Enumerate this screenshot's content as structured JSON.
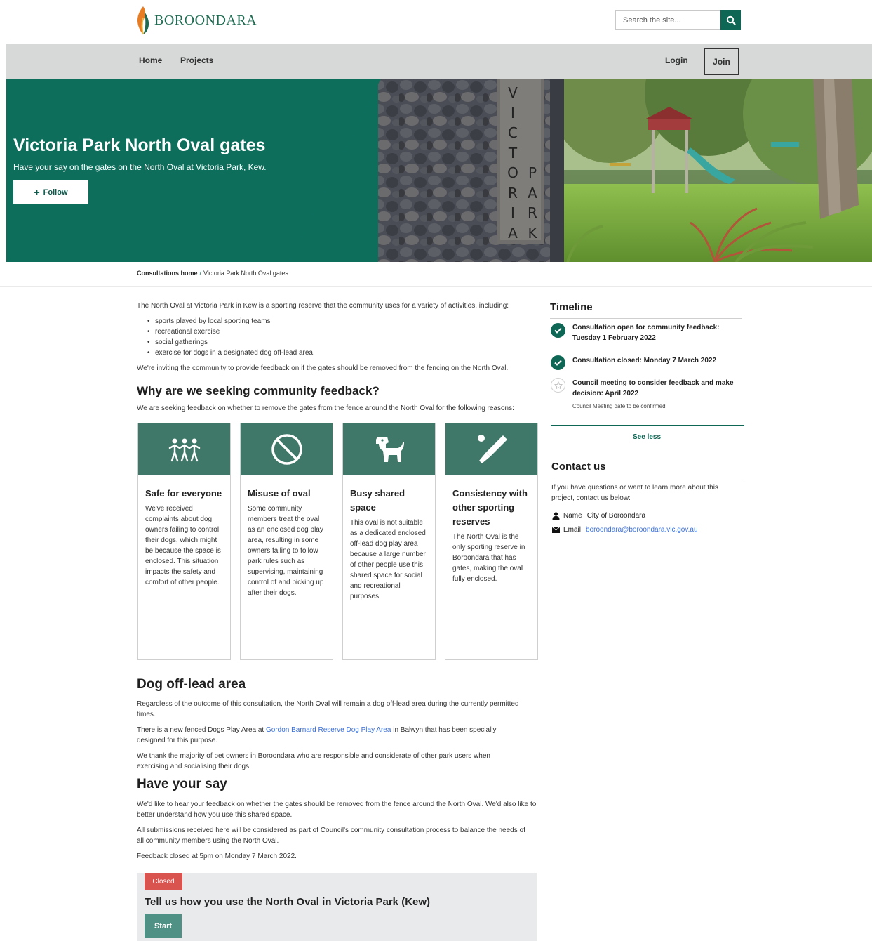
{
  "brand": {
    "logo_text": "Boroondara"
  },
  "search": {
    "placeholder": "Search the site..."
  },
  "nav": {
    "home": "Home",
    "projects": "Projects",
    "login": "Login",
    "join": "Join"
  },
  "hero": {
    "title": "Victoria Park North Oval gates",
    "subtitle": "Have your say on the gates on the North Oval at Victoria Park, Kew.",
    "follow_label": "Follow",
    "sign_letters_left": [
      "V",
      "I",
      "C",
      "T",
      "O",
      "R",
      "I",
      "A"
    ],
    "sign_letters_right": [
      "P",
      "A",
      "R",
      "K"
    ]
  },
  "breadcrumb": {
    "home": "Consultations home",
    "separator": "/",
    "current": "Victoria Park North Oval gates"
  },
  "main": {
    "intro": "The North Oval at Victoria Park in Kew is a sporting reserve that the community uses for a variety of activities, including:",
    "bullets": [
      "sports played by local sporting teams",
      "recreational exercise",
      "social gatherings",
      "exercise for dogs in a designated dog off-lead area."
    ],
    "inviting": "We're inviting the community to provide feedback on if the gates should be removed from the fencing on the North Oval.",
    "why_heading": "Why are we seeking community feedback?",
    "why_text": "We are seeking feedback on whether to remove the gates from the fence around the North Oval for the following reasons:",
    "cards": [
      {
        "icon": "people-icon",
        "title": "Safe for everyone",
        "body": "We've received complaints about dog owners failing to control their dogs, which might be because the space is enclosed. This situation impacts the safety and comfort of other people."
      },
      {
        "icon": "prohibited-icon",
        "title": "Misuse of oval",
        "body": "Some community members treat the oval as an enclosed dog play area, resulting in some owners failing to follow park rules such as supervising, maintaining control of and picking up after their dogs."
      },
      {
        "icon": "dog-icon",
        "title": "Busy shared space",
        "body": "This oval is not suitable as a dedicated enclosed off-lead dog play area because a large number of other people use this shared space for social and recreational purposes."
      },
      {
        "icon": "cricket-bat-icon",
        "title": "Consistency with other sporting reserves",
        "body": "The North Oval is the only sporting reserve in Boroondara that has gates, making the oval fully enclosed."
      }
    ],
    "dog_heading": "Dog off-lead area",
    "dog_p1": "Regardless of the outcome of this consultation, the North Oval will remain a dog off-lead area during the currently permitted times.",
    "dog_p2_before": "There is a new fenced Dogs Play Area at ",
    "dog_p2_link": "Gordon Barnard Reserve Dog Play Area",
    "dog_p2_after": " in Balwyn that has been specially designed for this purpose.",
    "dog_p3": "We thank the majority of pet owners in Boroondara who are responsible and considerate of other park users when exercising and socialising their dogs.",
    "say_heading": "Have your say",
    "say_p1": "We'd like to hear your feedback on whether the gates should be removed from the fence around the North Oval. We'd also like to better understand how you use this shared space.",
    "say_p2": "All submissions received here will be considered as part of Council's community consultation process to balance the needs of all community members using the North Oval.",
    "say_p3": "Feedback closed at 5pm on Monday 7 March 2022.",
    "survey": {
      "status": "Closed",
      "title": "Tell us how you use the North Oval in Victoria Park (Kew)",
      "start": "Start"
    }
  },
  "sidebar": {
    "timeline_heading": "Timeline",
    "timeline": [
      {
        "text": "Consultation open for community feedback: Tuesday 1 February 2022",
        "state": "complete"
      },
      {
        "text": "Consultation closed: Monday 7 March 2022",
        "state": "complete"
      },
      {
        "text": "Council meeting to consider feedback and make decision: April 2022",
        "state": "upcoming",
        "note": "Council Meeting date to be confirmed."
      }
    ],
    "see_less": "See less",
    "contact_heading": "Contact us",
    "contact_text": "If you have questions or want to learn more about this project, contact us below:",
    "name_label": "Name",
    "name_value": "City of Boroondara",
    "email_label": "Email",
    "email_value": "boroondara@boroondara.vic.gov.au"
  },
  "colors": {
    "brand_green": "#0e6655",
    "card_green": "#3f7868",
    "closed_red": "#d9534f",
    "link_blue": "#3b6fd8"
  }
}
